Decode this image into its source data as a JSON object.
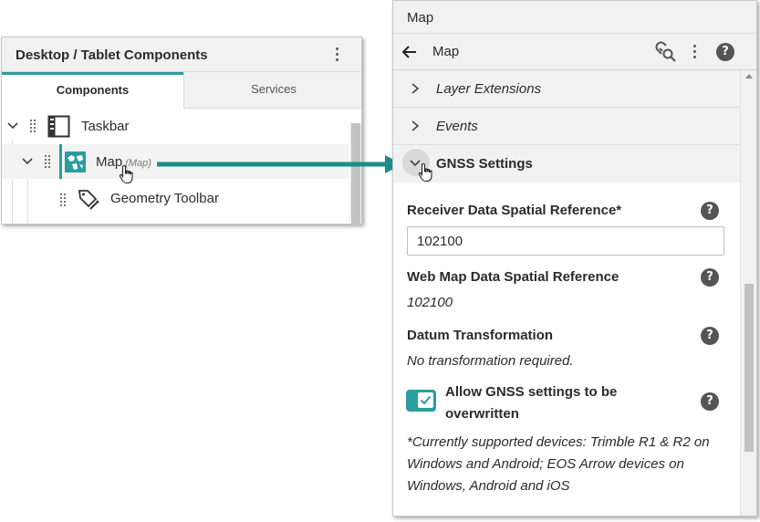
{
  "left_panel": {
    "title": "Desktop / Tablet Components",
    "tabs": [
      {
        "label": "Components",
        "active": true
      },
      {
        "label": "Services",
        "active": false
      }
    ],
    "tree": [
      {
        "label": "Taskbar",
        "sub": "",
        "icon": "taskbar-icon"
      },
      {
        "label": "Map",
        "sub": "(Map)",
        "icon": "map-icon",
        "selected": true
      },
      {
        "label": "Geometry Toolbar",
        "sub": "",
        "icon": "geometry-toolbar-icon"
      }
    ]
  },
  "right_panel": {
    "window_title": "Map",
    "nav_title": "Map",
    "sections": [
      {
        "label": "Layer Extensions",
        "expanded": false
      },
      {
        "label": "Events",
        "expanded": false
      },
      {
        "label": "GNSS Settings",
        "expanded": true
      }
    ],
    "gnss": {
      "receiver_label": "Receiver Data Spatial Reference*",
      "receiver_value": "102100",
      "webmap_label": "Web Map Data Spatial Reference",
      "webmap_value": "102100",
      "datum_label": "Datum Transformation",
      "datum_value": "No transformation required.",
      "allow_label": "Allow GNSS settings to be overwritten",
      "allow_checked": true,
      "footnote": "*Currently supported devices: Trimble R1 & R2 on Windows and Android; EOS Arrow devices on Windows, Android and iOS"
    },
    "help_glyph": "?"
  },
  "colors": {
    "accent": "#2a9d9d",
    "header_bg": "#f1f1f1",
    "text": "#2b2b2b"
  }
}
